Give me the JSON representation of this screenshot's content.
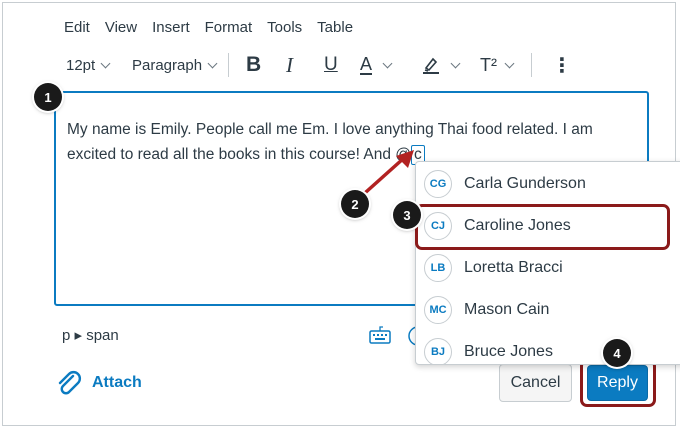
{
  "menubar": {
    "items": [
      "Edit",
      "View",
      "Insert",
      "Format",
      "Tools",
      "Table"
    ]
  },
  "toolbar": {
    "font_size": "12pt",
    "block_format": "Paragraph",
    "bold_label": "B",
    "italic_label": "I",
    "underline_label": "U",
    "text_color_label": "A",
    "superscript_label": "T²",
    "more_label": "⋮"
  },
  "editor": {
    "text_before": "My name is Emily. People call me Em. I love anything Thai food related. I am excited to read all the books in this course! And @",
    "typed_mention": "c"
  },
  "statusbar": {
    "path": "p ▸ span"
  },
  "mention_list": {
    "items": [
      {
        "initials": "CG",
        "name": "Carla Gunderson"
      },
      {
        "initials": "CJ",
        "name": "Caroline Jones"
      },
      {
        "initials": "LB",
        "name": "Loretta Bracci"
      },
      {
        "initials": "MC",
        "name": "Mason Cain"
      },
      {
        "initials": "BJ",
        "name": "Bruce Jones"
      }
    ],
    "highlighted": "Caroline Jones"
  },
  "actions": {
    "attach_label": "Attach",
    "cancel_label": "Cancel",
    "reply_label": "Reply"
  },
  "callouts": [
    "1",
    "2",
    "3",
    "4"
  ],
  "colors": {
    "accent": "#0b7bc1",
    "highlight": "#8b1a1a",
    "arrow": "#b22222",
    "text": "#2d3b45"
  }
}
